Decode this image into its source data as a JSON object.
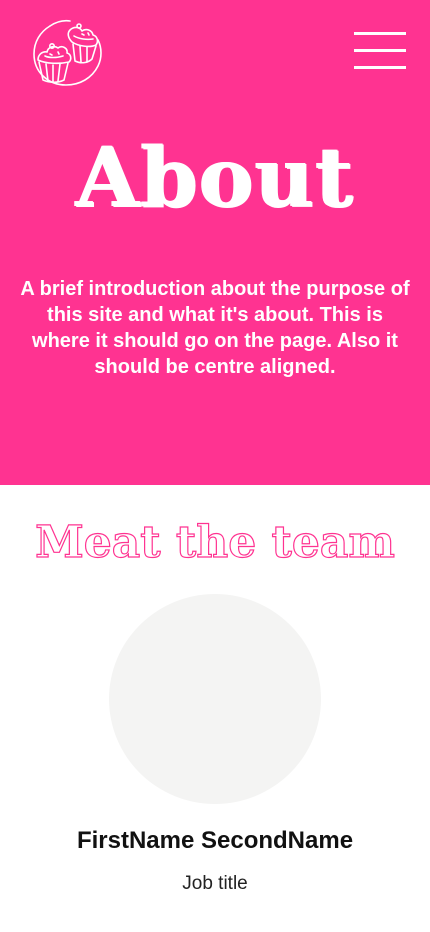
{
  "colors": {
    "brand_pink": "#ff3391",
    "avatar_placeholder": "#f4f4f3",
    "text_dark": "#111111"
  },
  "header": {
    "logo_icon": "cupcakes-logo-icon",
    "menu_icon": "hamburger-menu-icon"
  },
  "hero": {
    "title": "About",
    "intro": "A brief introduction about the purpose of this site and what it's about. This is where it should go on the page. Also it should be centre aligned."
  },
  "team": {
    "title": "Meat the team",
    "members": [
      {
        "name": "FirstName SecondName",
        "role": "Job title"
      }
    ]
  }
}
